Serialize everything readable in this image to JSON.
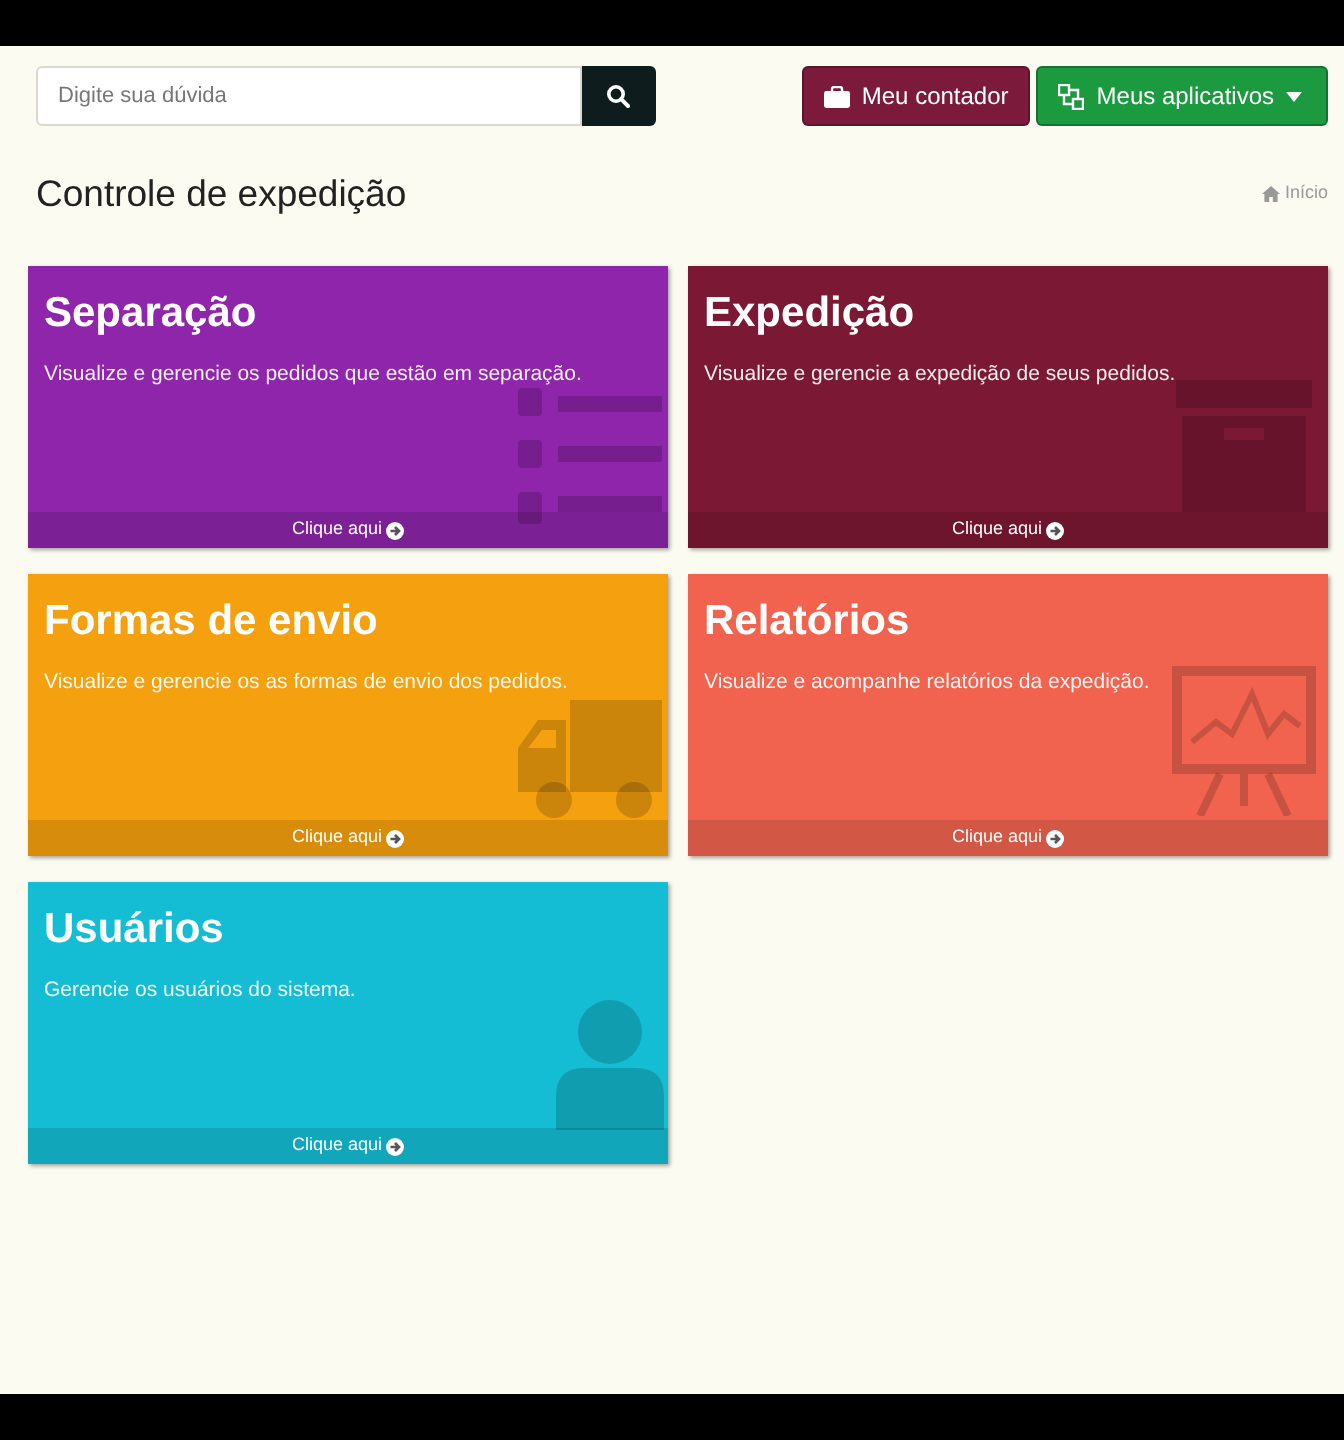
{
  "search": {
    "placeholder": "Digite sua dúvida"
  },
  "top_buttons": [
    {
      "label": "Meu contador",
      "kind": "button",
      "color": "#7c1a3c"
    },
    {
      "label": "Meus aplicativos",
      "kind": "dropdown",
      "color": "#1c9a40"
    }
  ],
  "page_title": "Controle de expedição",
  "breadcrumb": {
    "label": "Início"
  },
  "cards": [
    {
      "title": "Separação",
      "description": "Visualize e gerencie os pedidos que estão em separação.",
      "link": "Clique aqui",
      "color": "#8e25ab"
    },
    {
      "title": "Expedição",
      "description": "Visualize e gerencie a expedição de seus pedidos.",
      "link": "Clique aqui",
      "color": "#7b1834"
    },
    {
      "title": "Formas de envio",
      "description": "Visualize e gerencie os as formas de envio dos pedidos.",
      "link": "Clique aqui",
      "color": "#f5a00e"
    },
    {
      "title": "Relatórios",
      "description": "Visualize e acompanhe relatórios da expedição.",
      "link": "Clique aqui",
      "color": "#f1634f"
    },
    {
      "title": "Usuários",
      "description": "Gerencie os usuários do sistema.",
      "link": "Clique aqui",
      "color": "#14bdd3"
    }
  ]
}
